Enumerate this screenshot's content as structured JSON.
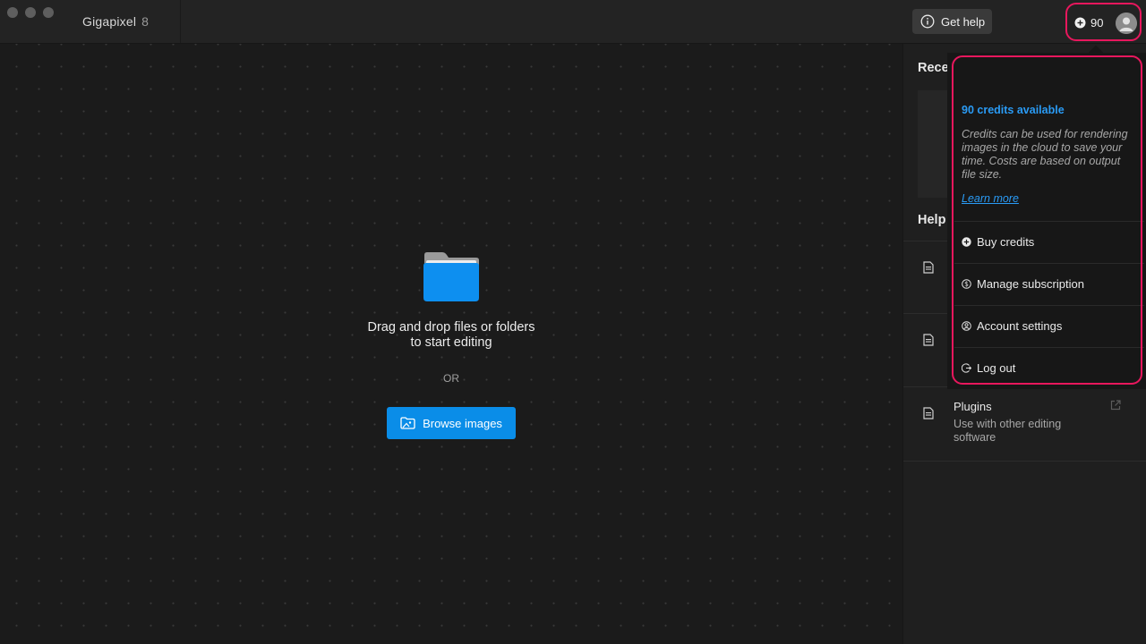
{
  "window": {
    "app_name": "Gigapixel",
    "app_version": "8"
  },
  "header": {
    "help_label": "Get help",
    "credits_count": "90"
  },
  "canvas": {
    "drop_line1": "Drag and drop files or folders",
    "drop_line2": "to start editing",
    "or_label": "OR",
    "browse_label": "Browse images"
  },
  "side_panel": {
    "recent_heading": "Rece",
    "help_heading": "Help",
    "plugins": {
      "title": "Plugins",
      "description": "Use with other editing software"
    }
  },
  "credits_menu": {
    "available": "90 credits available",
    "description": "Credits can be used for rendering images in the cloud to save your time. Costs are based on output file size.",
    "learn_more": "Learn more",
    "items": [
      {
        "label": "Buy credits",
        "icon": "plus-circle-icon"
      },
      {
        "label": "Manage subscription",
        "icon": "dollar-circle-icon"
      },
      {
        "label": "Account settings",
        "icon": "user-circle-icon"
      },
      {
        "label": "Log out",
        "icon": "logout-icon"
      }
    ]
  },
  "colors": {
    "accent": "#0a8de8",
    "link": "#2a9bf5",
    "highlight": "#e8175d",
    "background": "#1b1b1b"
  }
}
